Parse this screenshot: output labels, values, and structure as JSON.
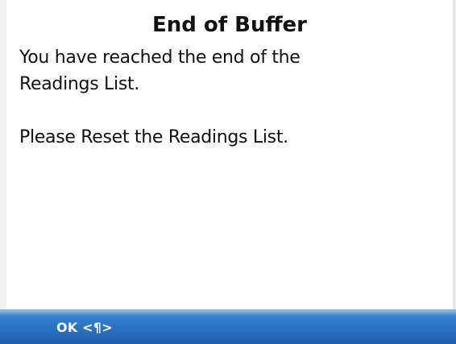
{
  "dialog": {
    "title": "End of Buffer",
    "message_line_1": "You have reached the end of the",
    "message_line_2": "Readings List.",
    "message_line_3": "Please Reset the Readings List."
  },
  "softkeys": {
    "left_label": "OK <¶>"
  },
  "colors": {
    "softkey_bar": "#2d75c4",
    "background": "#ffffff",
    "text": "#111111"
  }
}
